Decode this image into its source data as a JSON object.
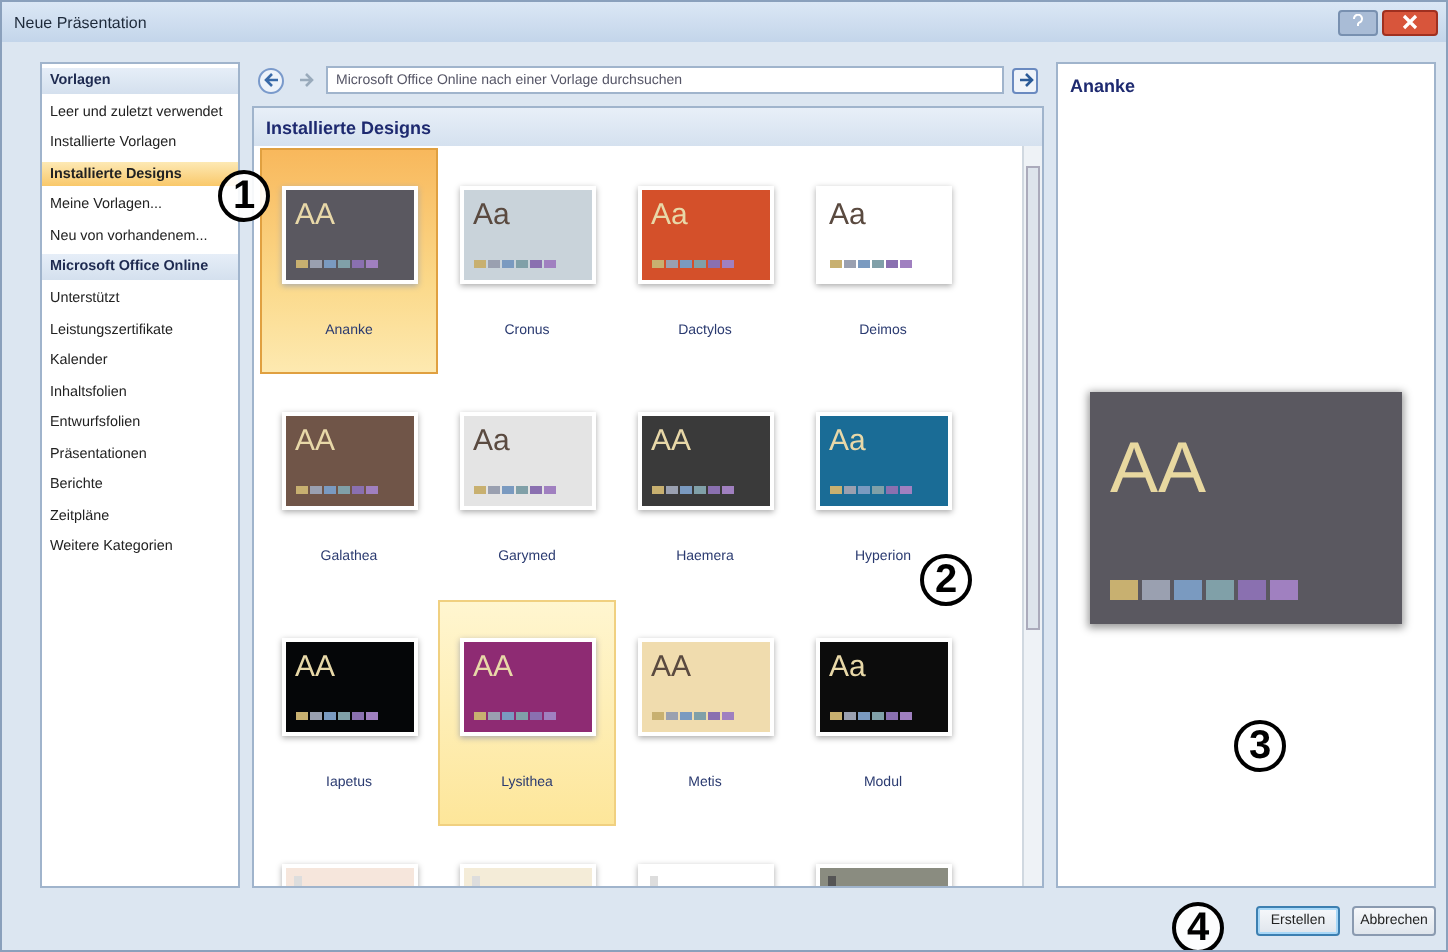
{
  "window": {
    "title": "Neue Präsentation"
  },
  "sidebar": {
    "items": [
      {
        "kind": "header",
        "label": "Vorlagen",
        "selected": false
      },
      {
        "kind": "item",
        "label": "Leer und zuletzt verwendet",
        "selected": false
      },
      {
        "kind": "item",
        "label": "Installierte Vorlagen",
        "selected": false
      },
      {
        "kind": "item",
        "label": "Installierte Designs",
        "selected": true
      },
      {
        "kind": "item",
        "label": "Meine Vorlagen...",
        "selected": false
      },
      {
        "kind": "item",
        "label": "Neu von vorhandenem...",
        "selected": false
      },
      {
        "kind": "header",
        "label": "Microsoft Office Online",
        "selected": false
      },
      {
        "kind": "item",
        "label": "Unterstützt",
        "selected": false
      },
      {
        "kind": "item",
        "label": "Leistungszertifikate",
        "selected": false
      },
      {
        "kind": "item",
        "label": "Kalender",
        "selected": false
      },
      {
        "kind": "item",
        "label": "Inhaltsfolien",
        "selected": false
      },
      {
        "kind": "item",
        "label": "Entwurfsfolien",
        "selected": false
      },
      {
        "kind": "item",
        "label": "Präsentationen",
        "selected": false
      },
      {
        "kind": "item",
        "label": "Berichte",
        "selected": false
      },
      {
        "kind": "item",
        "label": "Zeitpläne",
        "selected": false
      },
      {
        "kind": "item",
        "label": "Weitere Kategorien",
        "selected": false
      }
    ]
  },
  "search": {
    "placeholder": "Microsoft Office Online nach einer Vorlage durchsuchen"
  },
  "gallery": {
    "title": "Installierte Designs",
    "themes": [
      {
        "name": "Ananke",
        "sample": "AA",
        "color": "#5a5860",
        "dark": true,
        "selected": true,
        "hover": false
      },
      {
        "name": "Cronus",
        "sample": "Aa",
        "color": "#c9d3da",
        "dark": false,
        "selected": false,
        "hover": false
      },
      {
        "name": "Dactylos",
        "sample": "Aa",
        "color": "#d4502a",
        "dark": true,
        "selected": false,
        "hover": false
      },
      {
        "name": "Deimos",
        "sample": "Aa",
        "color": "#ffffff",
        "dark": false,
        "selected": false,
        "hover": false
      },
      {
        "name": "Galathea",
        "sample": "AA",
        "color": "#705548",
        "dark": true,
        "selected": false,
        "hover": false
      },
      {
        "name": "Garymed",
        "sample": "Aa",
        "color": "#e4e4e4",
        "dark": false,
        "selected": false,
        "hover": false
      },
      {
        "name": "Haemera",
        "sample": "AA",
        "color": "#3a3a3a",
        "dark": true,
        "selected": false,
        "hover": false
      },
      {
        "name": "Hyperion",
        "sample": "Aa",
        "color": "#1a6c96",
        "dark": true,
        "selected": false,
        "hover": false
      },
      {
        "name": "Iapetus",
        "sample": "AA",
        "color": "#050608",
        "dark": true,
        "selected": false,
        "hover": false
      },
      {
        "name": "Lysithea",
        "sample": "AA",
        "color": "#8e2b73",
        "dark": true,
        "selected": false,
        "hover": true
      },
      {
        "name": "Metis",
        "sample": "AA",
        "color": "#f0dcae",
        "dark": false,
        "selected": false,
        "hover": false
      },
      {
        "name": "Modul",
        "sample": "Aa",
        "color": "#0c0c0c",
        "dark": true,
        "selected": false,
        "hover": false
      },
      {
        "color": "#f6e6dc",
        "dark": false,
        "selected": false,
        "hover": false
      },
      {
        "color": "#f4ecd8",
        "dark": false,
        "selected": false,
        "hover": false
      },
      {
        "color": "#ffffff",
        "dark": false,
        "selected": false,
        "hover": false
      },
      {
        "color": "#8a8c80",
        "dark": true,
        "selected": false,
        "hover": false
      }
    ]
  },
  "preview": {
    "title": "Ananke",
    "sample": "AA",
    "color": "#5a5860"
  },
  "buttons": [
    {
      "label": "Erstellen",
      "default": true
    },
    {
      "label": "Abbrechen",
      "default": false
    }
  ],
  "callouts": [
    "1",
    "2",
    "3",
    "4"
  ]
}
